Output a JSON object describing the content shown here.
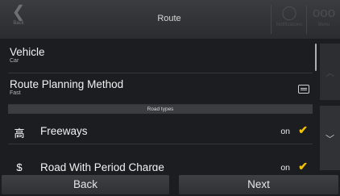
{
  "header": {
    "title": "Route",
    "back_label": "Back",
    "back_glyph": "❮",
    "right_buttons": [
      {
        "label": "Notifications",
        "icon": "speech-bubble-icon",
        "glyph": "◯"
      },
      {
        "label": "Menu",
        "icon": "menu-icon",
        "glyph": "ooo"
      }
    ]
  },
  "settings": {
    "vehicle": {
      "label": "Vehicle",
      "value": "Car"
    },
    "route_planning": {
      "label": "Route Planning Method",
      "value": "Fast"
    },
    "section_header": "Road types",
    "road_types": [
      {
        "label": "Freeways",
        "state": "on",
        "icon": "freeway-icon",
        "glyph": "⾼"
      },
      {
        "label": "Road With Period Charge",
        "state": "on",
        "icon": "toll-period-charge-icon",
        "glyph": "$"
      }
    ],
    "check_glyph": "✔"
  },
  "side": {
    "up_glyph": "︿",
    "down_glyph": "﹀"
  },
  "footer": {
    "back_label": "Back",
    "next_label": "Next"
  },
  "colors": {
    "accent": "#f1c300",
    "background": "#1b1d21"
  }
}
